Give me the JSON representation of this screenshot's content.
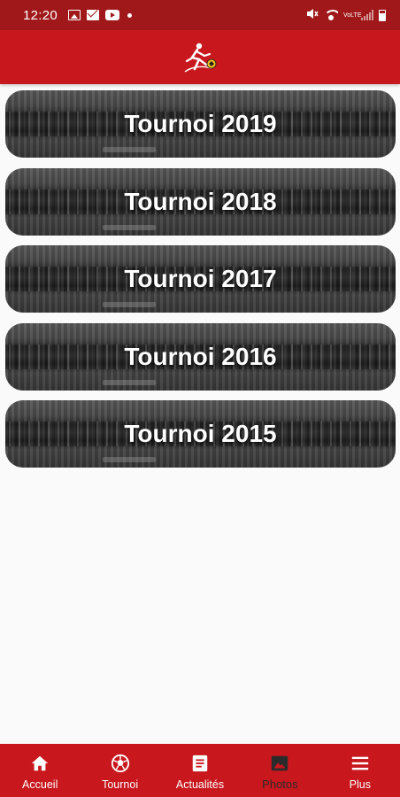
{
  "status_bar": {
    "time": "12:20",
    "icons": [
      "image-icon",
      "mail-icon",
      "youtube-icon",
      "dot-icon",
      "mute-icon",
      "wifi-icon",
      "volte-icon",
      "signal-icon",
      "battery-icon"
    ],
    "network_label": "VoLTE"
  },
  "header": {
    "logo": "football-player-logo",
    "brand_color": "#c8171d"
  },
  "tournaments": [
    {
      "label": "Tournoi 2019"
    },
    {
      "label": "Tournoi 2018"
    },
    {
      "label": "Tournoi 2017"
    },
    {
      "label": "Tournoi 2016"
    },
    {
      "label": "Tournoi 2015"
    }
  ],
  "bottom_nav": {
    "items": [
      {
        "label": "Accueil",
        "icon": "home-icon",
        "active": false
      },
      {
        "label": "Tournoi",
        "icon": "soccer-ball-icon",
        "active": false
      },
      {
        "label": "Actualités",
        "icon": "news-icon",
        "active": false
      },
      {
        "label": "Photos",
        "icon": "photo-icon",
        "active": true
      },
      {
        "label": "Plus",
        "icon": "menu-icon",
        "active": false
      }
    ],
    "active_color": "#2b2b2b"
  }
}
